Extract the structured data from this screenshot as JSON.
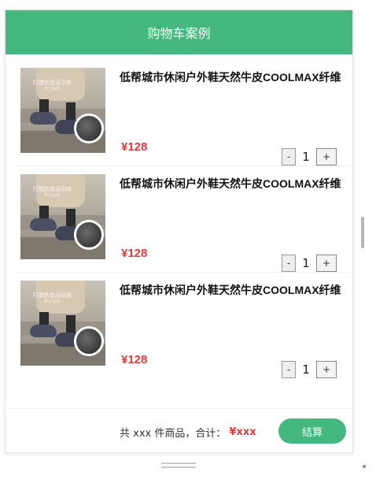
{
  "header": {
    "title": "购物车案例"
  },
  "items": [
    {
      "title": "低帮城市休闲户外鞋天然牛皮COOLMAX纤维",
      "price": "¥128",
      "quantity": "1",
      "image_watermark": "打造防臭运动袜",
      "image_watermark_sub": "男士运动"
    },
    {
      "title": "低帮城市休闲户外鞋天然牛皮COOLMAX纤维",
      "price": "¥128",
      "quantity": "1",
      "image_watermark": "打造防臭运动袜",
      "image_watermark_sub": "男士运动"
    },
    {
      "title": "低帮城市休闲户外鞋天然牛皮COOLMAX纤维",
      "price": "¥128",
      "quantity": "1",
      "image_watermark": "打造防臭运动袜",
      "image_watermark_sub": "男士运动"
    }
  ],
  "stepper": {
    "minus_label": "-",
    "plus_label": "+"
  },
  "footer": {
    "summary_text": "共 xxx 件商品，合计：",
    "total": "¥xxx",
    "checkout_label": "结算"
  },
  "colors": {
    "accent": "#44b87e",
    "price": "#e4393c"
  }
}
